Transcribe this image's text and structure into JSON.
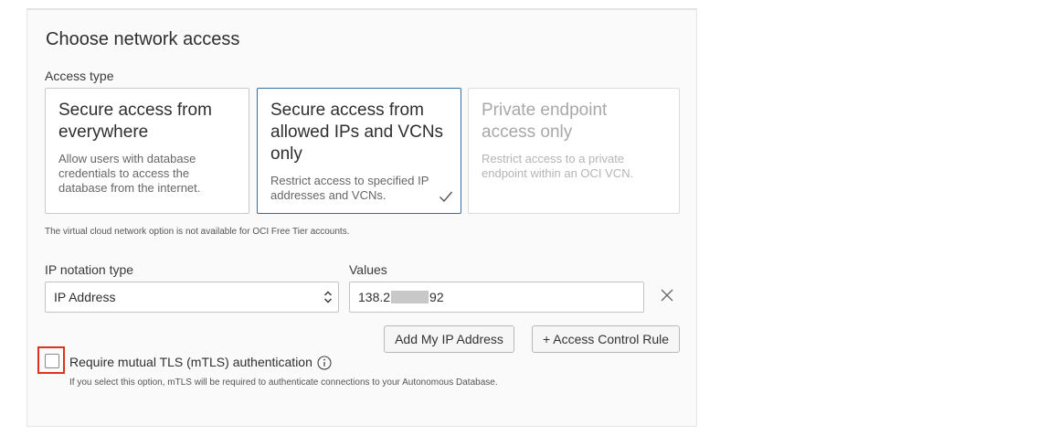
{
  "section": {
    "title": "Choose network access",
    "access_type_label": "Access type"
  },
  "cards": [
    {
      "title": "Secure access from everywhere",
      "description": "Allow users with database credentials to access the database from the internet.",
      "selected": false,
      "disabled": false
    },
    {
      "title": "Secure access from allowed IPs and VCNs only",
      "description": "Restrict access to specified IP addresses and VCNs.",
      "selected": true,
      "disabled": false
    },
    {
      "title": "Private endpoint access only",
      "description": "Restrict access to a private endpoint within an OCI VCN.",
      "selected": false,
      "disabled": true
    }
  ],
  "vcn_note": "The virtual cloud network option is not available for OCI Free Tier accounts.",
  "ip_notation": {
    "label": "IP notation type",
    "selected": "IP Address"
  },
  "values": {
    "label": "Values",
    "prefix": "138.2",
    "suffix": "92"
  },
  "buttons": {
    "add_my_ip": "Add My IP Address",
    "access_control_rule": "+ Access Control Rule"
  },
  "mtls": {
    "label": "Require mutual TLS (mTLS) authentication",
    "checked": false,
    "hint": "If you select this option, mTLS will be required to authenticate connections to your Autonomous Database."
  },
  "icons": {
    "check": "checkmark-icon",
    "select": "select-stepper-icon",
    "clear": "close-icon",
    "info": "info-icon"
  },
  "colors": {
    "selected_border": "#2d6fa8",
    "highlight": "#e0301e"
  }
}
